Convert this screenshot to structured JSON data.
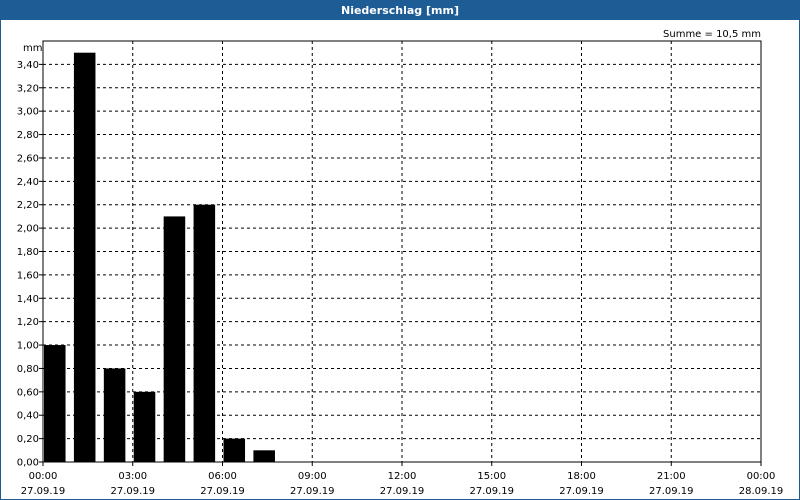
{
  "window": {
    "title": "Niederschlag [mm]"
  },
  "chart_data": {
    "type": "bar",
    "title": "Niederschlag [mm]",
    "ylabel": "mm",
    "annotation": "Summe = 10,5 mm",
    "ylim": [
      0,
      3.6
    ],
    "y_ticks": [
      "0,00",
      "0,20",
      "0,40",
      "0,60",
      "0,80",
      "1,00",
      "1,20",
      "1,40",
      "1,60",
      "1,80",
      "2,00",
      "2,20",
      "2,40",
      "2,60",
      "2,80",
      "3,00",
      "3,20",
      "3,40"
    ],
    "x_ticks": [
      {
        "time": "00:00",
        "date": "27.09.19"
      },
      {
        "time": "03:00",
        "date": "27.09.19"
      },
      {
        "time": "06:00",
        "date": "27.09.19"
      },
      {
        "time": "09:00",
        "date": "27.09.19"
      },
      {
        "time": "12:00",
        "date": "27.09.19"
      },
      {
        "time": "15:00",
        "date": "27.09.19"
      },
      {
        "time": "18:00",
        "date": "27.09.19"
      },
      {
        "time": "21:00",
        "date": "27.09.19"
      },
      {
        "time": "00:00",
        "date": "28.09.19"
      }
    ],
    "categories": [
      "00:00",
      "01:00",
      "02:00",
      "03:00",
      "04:00",
      "05:00",
      "06:00",
      "07:00"
    ],
    "values": [
      1.0,
      3.5,
      0.8,
      0.6,
      2.1,
      2.2,
      0.2,
      0.1
    ],
    "x_range_hours": [
      0,
      24
    ],
    "bar_color": "#000000",
    "grid": true
  }
}
